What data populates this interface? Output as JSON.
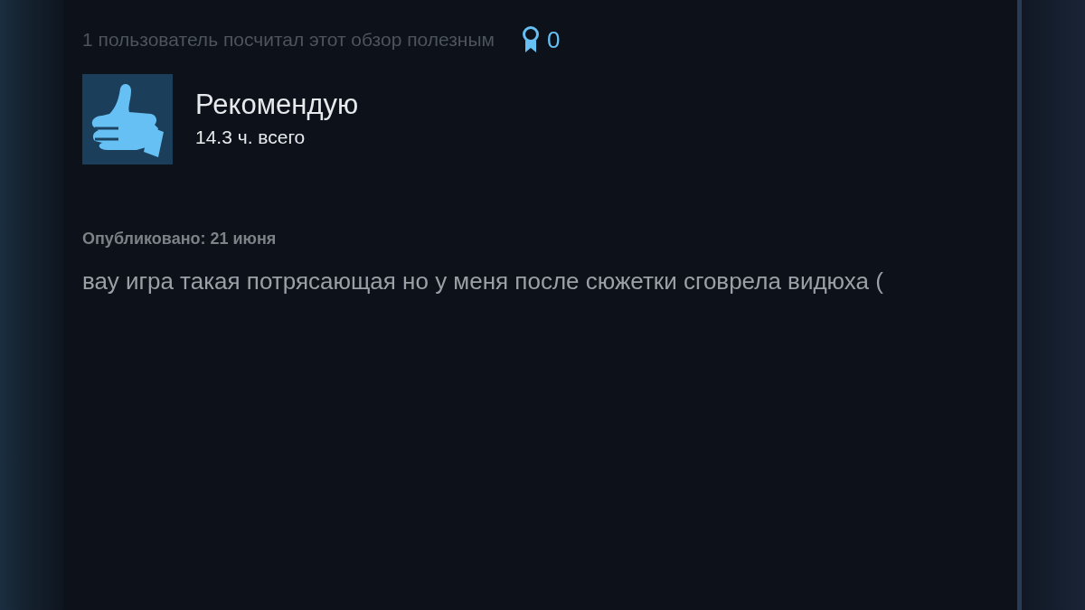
{
  "review": {
    "helpful_text": "1 пользователь посчитал этот обзор полезным",
    "awards": "0",
    "verdict": {
      "kind": "recommended",
      "label": "Рекомендую"
    },
    "hours": "14.3 ч. всего",
    "posted": "Опубликовано: 21 июня",
    "body": "вау игра такая потрясающая но у меня после сюжетки сговрела видюха ("
  }
}
